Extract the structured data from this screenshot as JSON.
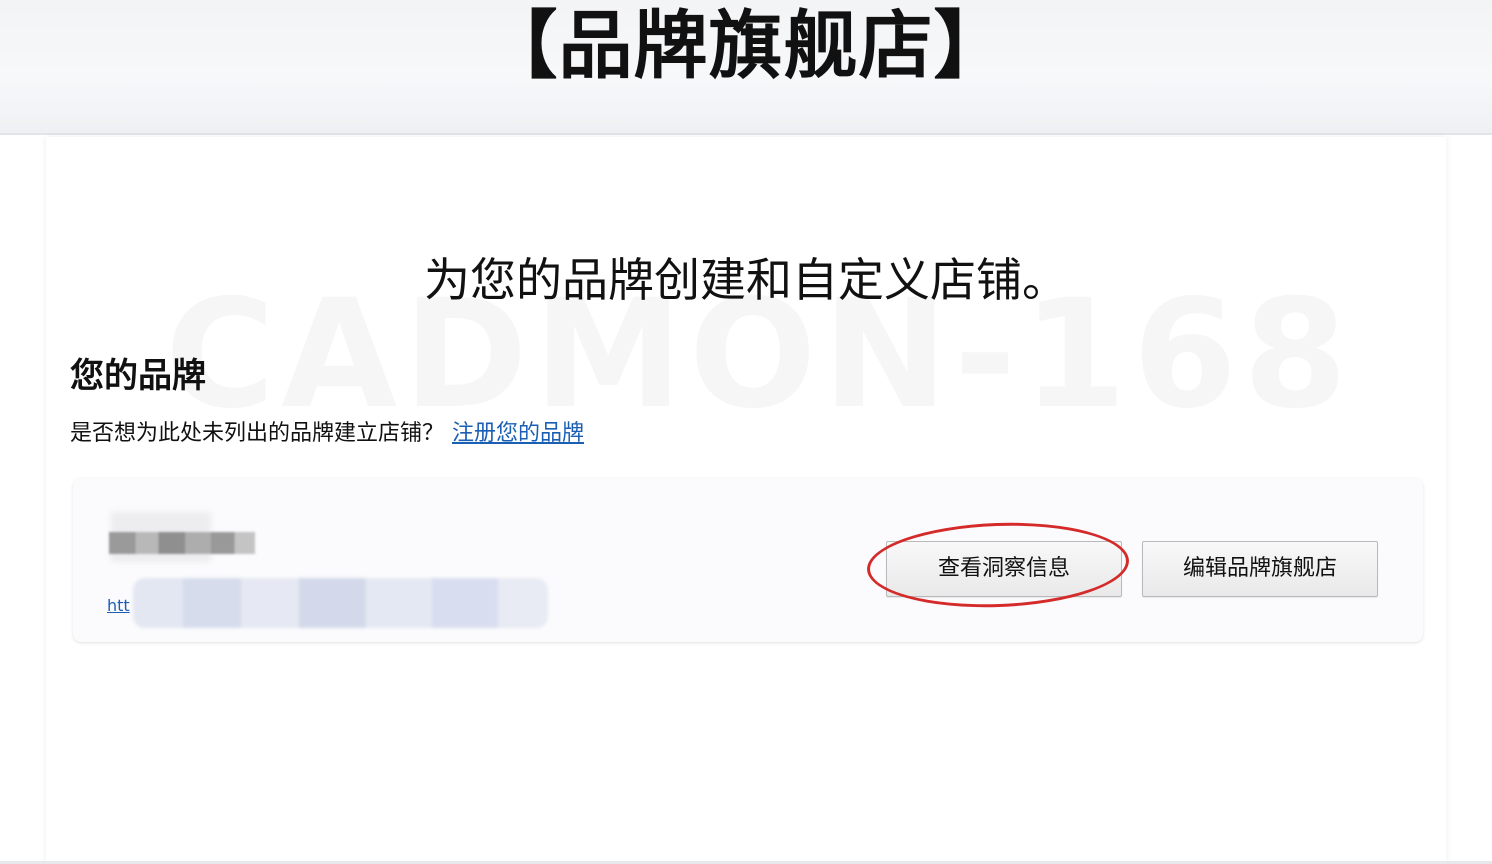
{
  "banner": {
    "title": "【品牌旗舰店】"
  },
  "watermark": {
    "text": "CADMON-168"
  },
  "main": {
    "headline": "为您的品牌创建和自定义店铺。",
    "section_title": "您的品牌",
    "section_subtitle": "是否想为此处未列出的品牌建立店铺？",
    "register_link": "注册您的品牌"
  },
  "brand_card": {
    "link_fragment": "htt",
    "buttons": {
      "view_insights": "查看洞察信息",
      "edit_store": "编辑品牌旗舰店"
    }
  },
  "colors": {
    "link": "#1a5fb4",
    "highlight": "#d42a2a",
    "button_border": "#b9b9b9"
  }
}
